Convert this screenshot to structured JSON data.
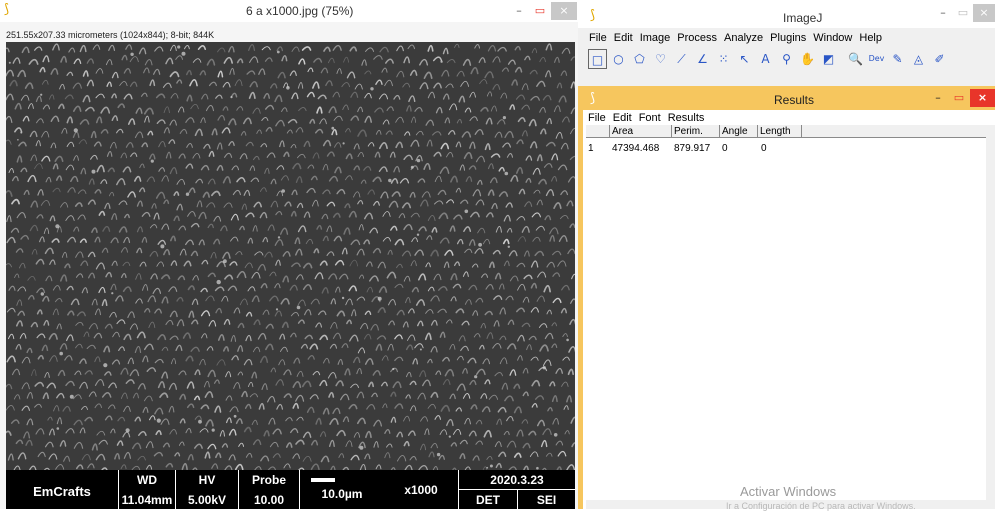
{
  "image_window": {
    "title": "6 a x1000.jpg (75%)",
    "info": "251.55x207.33 micrometers (1024x844); 8-bit; 844K",
    "controls": {
      "minimize": "–",
      "maximize": "▭",
      "close": "×"
    }
  },
  "sem_databar": {
    "brand": "EmCrafts",
    "wd_label": "WD",
    "wd_value": "11.04mm",
    "hv_label": "HV",
    "hv_value": "5.00kV",
    "probe_label": "Probe",
    "probe_value": "10.00",
    "scale": "10.0µm",
    "magnification": "x1000",
    "date": "2020.3.23",
    "det_label": "DET",
    "det_value": "SEI"
  },
  "imagej_window": {
    "title": "ImageJ",
    "menu": [
      "File",
      "Edit",
      "Image",
      "Process",
      "Analyze",
      "Plugins",
      "Window",
      "Help"
    ],
    "tools": [
      {
        "name": "rectangle-tool-icon",
        "glyph": "□"
      },
      {
        "name": "oval-tool-icon",
        "glyph": "○"
      },
      {
        "name": "polygon-tool-icon",
        "glyph": "⬠"
      },
      {
        "name": "freehand-tool-icon",
        "glyph": "♡"
      },
      {
        "name": "line-tool-icon",
        "glyph": "⟋"
      },
      {
        "name": "angle-tool-icon",
        "glyph": "∠"
      },
      {
        "name": "point-tool-icon",
        "glyph": "⁙"
      },
      {
        "name": "wand-tool-icon",
        "glyph": "↖"
      },
      {
        "name": "text-tool-icon",
        "glyph": "A"
      },
      {
        "name": "zoom-tool-icon",
        "glyph": "⚲"
      },
      {
        "name": "hand-tool-icon",
        "glyph": "✋"
      },
      {
        "name": "dropper-tool-icon",
        "glyph": "◩"
      },
      {
        "name": "magnifier-tool-icon",
        "glyph": "🔍"
      },
      {
        "name": "developer-menu-icon",
        "glyph": "Dev"
      },
      {
        "name": "brush-tool-icon",
        "glyph": "✎"
      },
      {
        "name": "flood-fill-tool-icon",
        "glyph": "◬"
      },
      {
        "name": "pencil-tool-icon",
        "glyph": "✐"
      }
    ]
  },
  "results_window": {
    "title": "Results",
    "menu": [
      "File",
      "Edit",
      "Font",
      "Results"
    ],
    "columns": [
      "",
      "Area",
      "Perim.",
      "Angle",
      "Length"
    ],
    "rows": [
      [
        "1",
        "47394.468",
        "879.917",
        "0",
        "0"
      ]
    ]
  },
  "watermark": {
    "title": "Activar Windows",
    "subtitle": "Ir a Configuración de PC para activar Windows."
  },
  "colors": {
    "results_frame": "#f6c65e",
    "close_red": "#e8352a",
    "tool_blue": "#2a56c6"
  }
}
